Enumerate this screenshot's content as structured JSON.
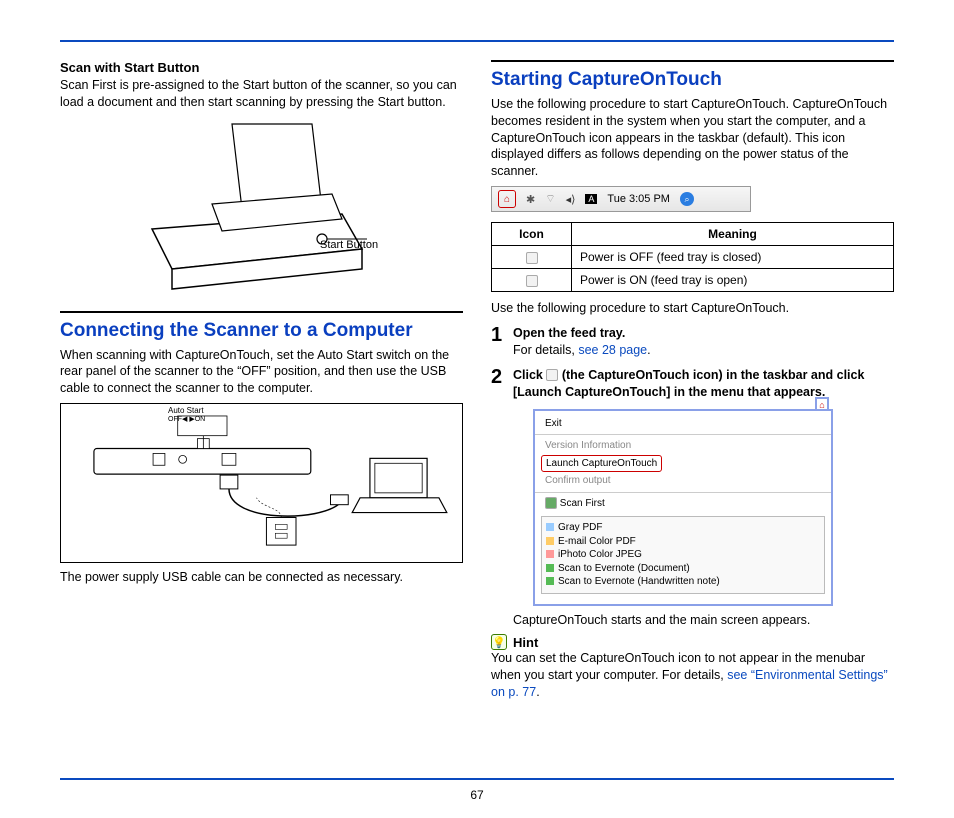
{
  "page_number": "67",
  "left": {
    "sub1_title": "Scan with Start Button",
    "sub1_text": "Scan First is pre-assigned to the Start button of the scanner, so you can load a document and then start scanning by pressing the Start button.",
    "start_button_label": "Start Button",
    "heading": "Connecting the Scanner to a Computer",
    "para1": "When scanning with CaptureOnTouch, set the Auto Start switch on the rear panel of the scanner to the “OFF” position, and then use the USB cable to connect the scanner to the computer.",
    "auto_start_label": "Auto Start",
    "switch_label": "OFF◀  ▶ON",
    "caption": "The power supply USB cable can be connected as necessary."
  },
  "right": {
    "heading": "Starting CaptureOnTouch",
    "intro": "Use the following procedure to start CaptureOnTouch. CaptureOnTouch becomes resident in the system when you start the computer, and a CaptureOnTouch icon appears in the taskbar (default). This icon displayed differs as follows depending on the power status of the scanner.",
    "menubar_time": "Tue 3:05 PM",
    "table": {
      "h1": "Icon",
      "h2": "Meaning",
      "r1": "Power is OFF (feed tray is closed)",
      "r2": "Power is ON (feed tray is open)"
    },
    "para_after_table": "Use the following procedure to start CaptureOnTouch.",
    "step1_num": "1",
    "step1_title": "Open the feed tray.",
    "step1_detail_a": "For details, ",
    "step1_detail_link": "see 28 page",
    "step1_detail_b": ".",
    "step2_num": "2",
    "step2_a": "Click ",
    "step2_b": " (the CaptureOnTouch icon) in the taskbar and click [Launch CaptureOnTouch] in the menu that appears.",
    "menu": {
      "exit": "Exit",
      "version": "Version Information",
      "launch": "Launch CaptureOnTouch",
      "confirm": "Confirm output",
      "scan_first": "Scan First",
      "opt1": "Gray PDF",
      "opt2": "E-mail Color PDF",
      "opt3": "iPhoto Color JPEG",
      "opt4": "Scan to Evernote (Document)",
      "opt5": "Scan to Evernote (Handwritten note)"
    },
    "after_menu": "CaptureOnTouch starts and the main screen appears.",
    "hint_label": "Hint",
    "hint_text_a": "You can set the CaptureOnTouch icon to not appear in the menubar when you start your computer. For details, ",
    "hint_link": "see “Environmental Settings” on p. 77",
    "hint_text_b": "."
  }
}
